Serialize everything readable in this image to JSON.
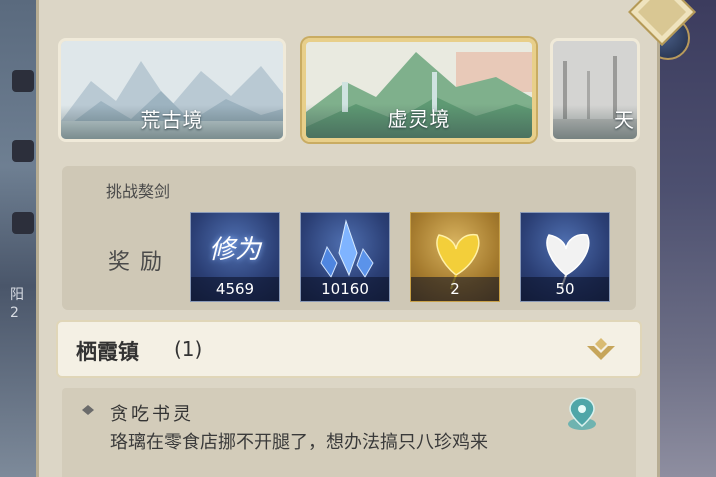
{
  "realms": [
    {
      "name": "荒古境",
      "selected": false
    },
    {
      "name": "虚灵境",
      "selected": true
    },
    {
      "name": "天",
      "selected": false
    }
  ],
  "sidebar": {
    "partial_text": "阳\n2"
  },
  "challenge": {
    "title": "挑战獒剑",
    "reward_label": "奖励",
    "rewards": [
      {
        "icon": "cultivation-icon",
        "icon_text": "修为",
        "quantity": "4569"
      },
      {
        "icon": "blue-crystal-icon",
        "quantity": "10160"
      },
      {
        "icon": "gold-ginkgo-leaf-icon",
        "quantity": "2"
      },
      {
        "icon": "silver-ginkgo-leaf-icon",
        "quantity": "50"
      }
    ]
  },
  "location": {
    "name": "栖霞镇",
    "count": "(1)"
  },
  "quest": {
    "title": "贪吃书灵",
    "description": "珞璃在零食店挪不开腿了，想办法搞只八珍鸡来"
  },
  "colors": {
    "panel": "#dcd6c6",
    "selected_border": "#e8cf8a",
    "reward_blue": "#2b3f75",
    "reward_gold": "#a57b2e"
  }
}
